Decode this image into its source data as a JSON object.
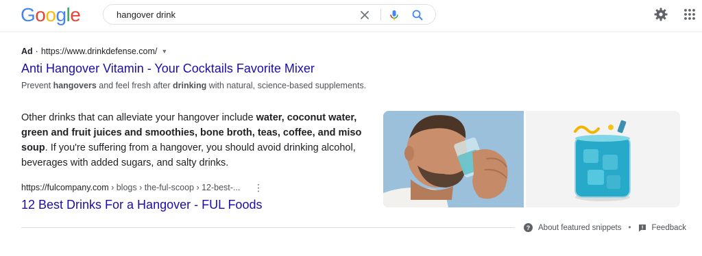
{
  "header": {
    "logo_letters": [
      "G",
      "o",
      "o",
      "g",
      "l",
      "e"
    ],
    "logo_colors": [
      "#4285F4",
      "#EA4335",
      "#FBBC05",
      "#4285F4",
      "#34A853",
      "#EA4335"
    ],
    "search": {
      "value": "hangover drink"
    },
    "icons": {
      "clear": "close-icon",
      "mic": "mic-icon",
      "search": "search-icon",
      "settings": "gear-icon",
      "apps": "apps-grid-icon"
    }
  },
  "ad": {
    "label": "Ad",
    "separator": "·",
    "url": "https://www.drinkdefense.com/",
    "title": "Anti Hangover Vitamin - Your Cocktails Favorite Mixer",
    "desc_parts": [
      "Prevent ",
      "hangovers",
      " and feel fresh after ",
      "drinking",
      " with natural, science-based supplements."
    ]
  },
  "snippet": {
    "parts": [
      "Other drinks that can alleviate your hangover include ",
      "water, coconut water, green and fruit juices and smoothies, bone broth, teas, coffee, and miso soup",
      ". If you're suffering from a hangover, you should avoid drinking alcohol, beverages with added sugars, and salty drinks."
    ]
  },
  "result": {
    "domain": "https://fulcompany.com",
    "breadcrumbs": " › blogs › the-ful-scoop › 12-best-...",
    "more": "⋮",
    "title": "12 Best Drinks For a Hangover - FUL Foods"
  },
  "footer": {
    "about": "About featured snippets",
    "separator": "•",
    "feedback": "Feedback"
  },
  "colors": {
    "link": "#1a0dab",
    "text": "#202124",
    "muted": "#4d5156",
    "accent_blue": "#4285F4"
  }
}
